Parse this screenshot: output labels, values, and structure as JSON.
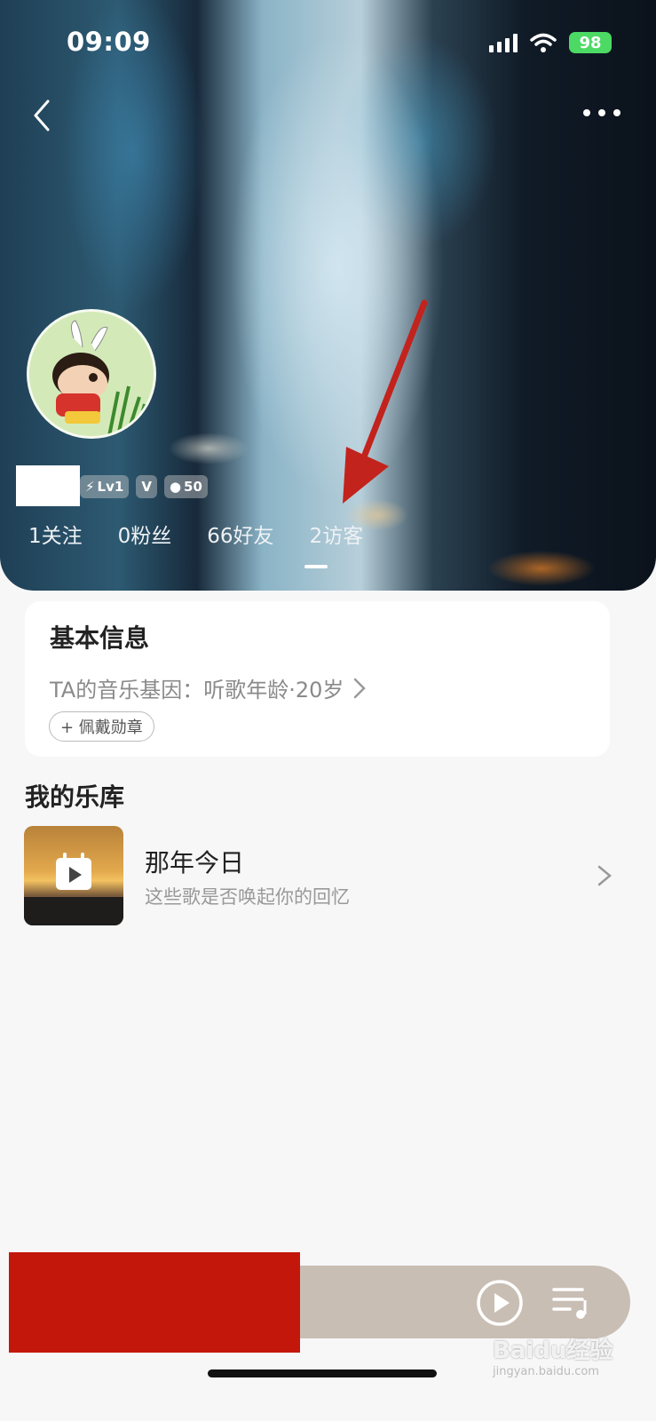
{
  "status_bar": {
    "time": "09:09",
    "battery": "98"
  },
  "profile": {
    "badges": [
      {
        "icon": "lightning-icon",
        "label": "Lv1"
      },
      {
        "icon": "vip-icon",
        "label": ""
      },
      {
        "icon": "ring-icon",
        "label": "50"
      }
    ],
    "stats": [
      "1关注",
      "0粉丝",
      "66好友",
      "2访客"
    ]
  },
  "info_card": {
    "title": "基本信息",
    "music_gene": "TA的音乐基因：听歌年龄·20岁",
    "medal_button": "+ 佩戴勋章"
  },
  "library": {
    "title": "我的乐库",
    "item": {
      "name": "那年今日",
      "subtitle": "这些歌是否唤起你的回忆"
    }
  },
  "watermark": {
    "brand": "Baidu经验",
    "url": "jingyan.baidu.com"
  },
  "colors": {
    "accent_arrow": "#c2231c",
    "redaction": "#c4170c",
    "player_bar": "#c9beb4"
  }
}
